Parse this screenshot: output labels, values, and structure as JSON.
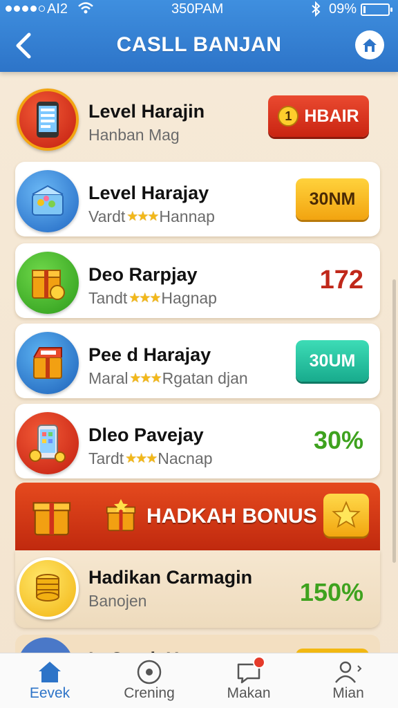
{
  "status_bar": {
    "carrier": "AI2",
    "time": "350PAM",
    "battery": "09%",
    "battery_level": 0.09
  },
  "header": {
    "title": "CASLL BANJAN",
    "back_icon": "chevron-left-icon",
    "home_icon": "home-icon"
  },
  "rows": [
    {
      "title": "Level Harajin",
      "subtitle_prefix": "Hanban Mag",
      "subtitle_suffix": "",
      "stars": "",
      "icon": "phone-icon",
      "action_type": "pill-red",
      "action_badge": "1",
      "action_label": "HBAIR"
    },
    {
      "title": "Level Harajay",
      "subtitle_prefix": "Vardt",
      "stars": "★★★",
      "subtitle_suffix": "Hannap",
      "icon": "gift-box-icon",
      "action_type": "pill-yellow",
      "action_label": "30NM"
    },
    {
      "title": "Deo Rarpjay",
      "subtitle_prefix": "Tandt",
      "stars": "★★★",
      "subtitle_suffix": "Hagnap",
      "icon": "treasure-box-icon",
      "action_type": "value",
      "action_label": "172",
      "action_color": "#c0281a"
    },
    {
      "title": "Pee d Harajay",
      "subtitle_prefix": "Maral",
      "stars": "★★★",
      "subtitle_suffix": "Rgatan djan",
      "icon": "gift-box-icon",
      "action_type": "pill-teal",
      "action_label": "30UM"
    },
    {
      "title": "Dleo Pavejay",
      "subtitle_prefix": "Tardt",
      "stars": "★★★",
      "subtitle_suffix": "Nacnap",
      "icon": "phone-coins-icon",
      "action_type": "value",
      "action_label": "30%",
      "action_color": "#3ea21e"
    }
  ],
  "bonus": {
    "banner_label": "HADKAH BONUS",
    "title": "Hadikan Carmagin",
    "subtitle": "Banojen",
    "value": "150%",
    "value_color": "#3ea21e",
    "icon": "coin-stack-icon",
    "star_icon": "star-icon"
  },
  "partial_row": {
    "title": "L  C    d  H"
  },
  "tabs": [
    {
      "label": "Eevek",
      "icon": "home-icon",
      "active": true
    },
    {
      "label": "Crening",
      "icon": "record-icon",
      "active": false
    },
    {
      "label": "Makan",
      "icon": "chat-icon",
      "active": false
    },
    {
      "label": "Mian",
      "icon": "profile-icon",
      "active": false
    }
  ],
  "colors": {
    "header_blue": "#2d74c8",
    "accent_red": "#c92411",
    "accent_green": "#3ea21e",
    "accent_teal": "#18ab8d",
    "accent_yellow": "#f2a410"
  }
}
